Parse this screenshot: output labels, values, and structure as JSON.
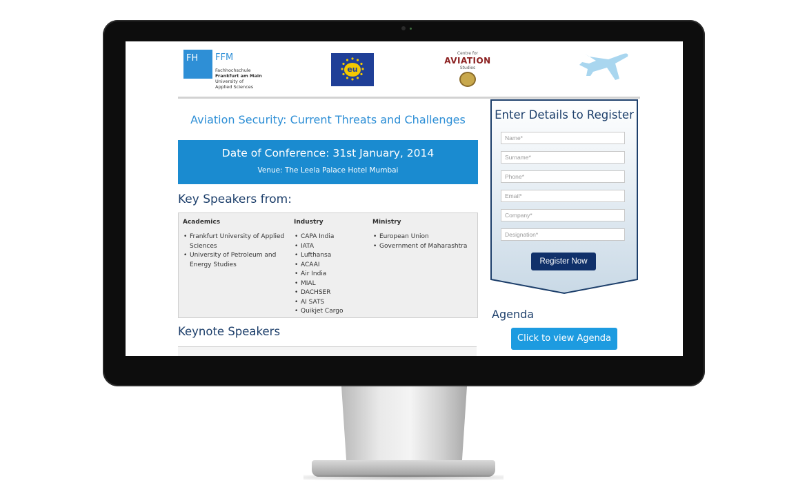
{
  "logos": {
    "fh": {
      "box_label": "FH",
      "ffm": "FFM",
      "line1": "Fachhochschule",
      "line2": "Frankfurt am Main",
      "line3": "University of",
      "line4": "Applied Sciences"
    },
    "eu": {
      "label": "eu"
    },
    "cas": {
      "top": "Centre for",
      "main": "AVIATION",
      "sub": "Studies"
    }
  },
  "conference": {
    "title": "Aviation Security: Current Threats and Challenges",
    "date": "Date of Conference: 31st January, 2014",
    "venue": "Venue: The Leela Palace Hotel Mumbai"
  },
  "speakers": {
    "heading": "Key Speakers from:",
    "columns": [
      {
        "header": "Academics",
        "items": [
          "Frankfurt University of Applied Sciences",
          "University of Petroleum and Energy Studies"
        ]
      },
      {
        "header": "Industry",
        "items": [
          "CAPA India",
          "IATA",
          "Lufthansa",
          "ACAAI",
          "Air India",
          "MIAL",
          "DACHSER",
          "AI SATS",
          "Quikjet Cargo"
        ]
      },
      {
        "header": "Ministry",
        "items": [
          "European Union",
          "Government of Maharashtra"
        ]
      }
    ]
  },
  "keynote": {
    "heading": "Keynote Speakers"
  },
  "register": {
    "title": "Enter Details to Register",
    "fields": [
      "Name*",
      "Surname*",
      "Phone*",
      "Email*",
      "Company*",
      "Designation*"
    ],
    "button": "Register Now"
  },
  "agenda": {
    "heading": "Agenda",
    "button": "Click to view Agenda"
  },
  "colors": {
    "accent": "#1a8bd0",
    "navy": "#10306a",
    "heading": "#1d3f6b"
  }
}
